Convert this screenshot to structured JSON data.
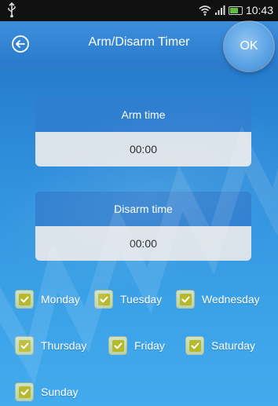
{
  "status_bar": {
    "time": "10:43",
    "usb_icon": "usb-icon",
    "wifi_icon": "wifi-icon",
    "signal_icon": "signal-icon",
    "battery_icon": "battery-icon",
    "battery_level": 0.7
  },
  "header": {
    "title": "Arm/Disarm Timer",
    "back_icon": "back-arrow-icon",
    "ok_label": "OK"
  },
  "arm": {
    "label": "Arm time",
    "value": "00:00"
  },
  "disarm": {
    "label": "Disarm time",
    "value": "00:00"
  },
  "days": [
    {
      "label": "Monday",
      "checked": true
    },
    {
      "label": "Tuesday",
      "checked": true
    },
    {
      "label": "Wednesday",
      "checked": true
    },
    {
      "label": "Thursday",
      "checked": true
    },
    {
      "label": "Friday",
      "checked": true
    },
    {
      "label": "Saturday",
      "checked": true
    },
    {
      "label": "Sunday",
      "checked": true
    }
  ],
  "colors": {
    "background": "#2d8ad8",
    "header": "#2a79cc",
    "card_label": "#2f7fd0",
    "card_value": "#dbe3ea",
    "checkbox": "#b7b92c"
  }
}
